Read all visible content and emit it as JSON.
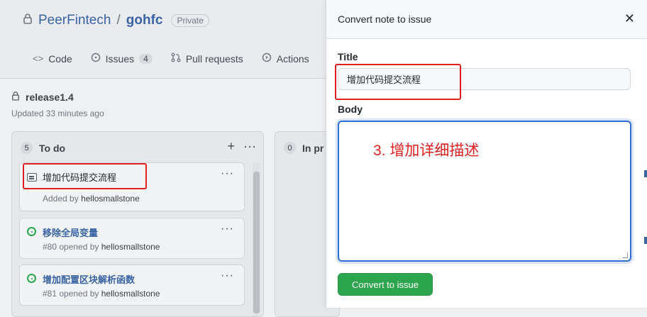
{
  "repo": {
    "owner": "PeerFintech",
    "separator": "/",
    "name": "gohfc",
    "visibility": "Private"
  },
  "tabs": [
    {
      "label": "Code",
      "icon": "code-icon"
    },
    {
      "label": "Issues",
      "icon": "issue-icon",
      "count": "4"
    },
    {
      "label": "Pull requests",
      "icon": "pull-request-icon"
    },
    {
      "label": "Actions",
      "icon": "actions-icon"
    }
  ],
  "project": {
    "title": "release1.4",
    "updated": "Updated 33 minutes ago"
  },
  "columns": [
    {
      "count": "5",
      "name": "To do",
      "cards": [
        {
          "type": "note",
          "title": "增加代码提交流程",
          "sub_prefix": "Added by",
          "user": "hellosmallstone"
        },
        {
          "type": "issue",
          "title": "移除全局变量",
          "sub_prefix": "#80 opened by",
          "user": "hellosmallstone"
        },
        {
          "type": "issue",
          "title": "增加配置区块解析函数",
          "sub_prefix": "#81 opened by",
          "user": "hellosmallstone"
        }
      ]
    },
    {
      "count": "0",
      "name": "In pr"
    }
  ],
  "modal": {
    "title": "Convert note to issue",
    "title_label": "Title",
    "title_value": "增加代码提交流程",
    "body_label": "Body",
    "body_annotation": "3. 增加详细描述",
    "submit_label": "Convert to issue"
  },
  "colors": {
    "accent_link": "#3a63a3",
    "success": "#2da44e",
    "annotation_red": "#e02020",
    "focus_blue": "#2f6fd1"
  }
}
